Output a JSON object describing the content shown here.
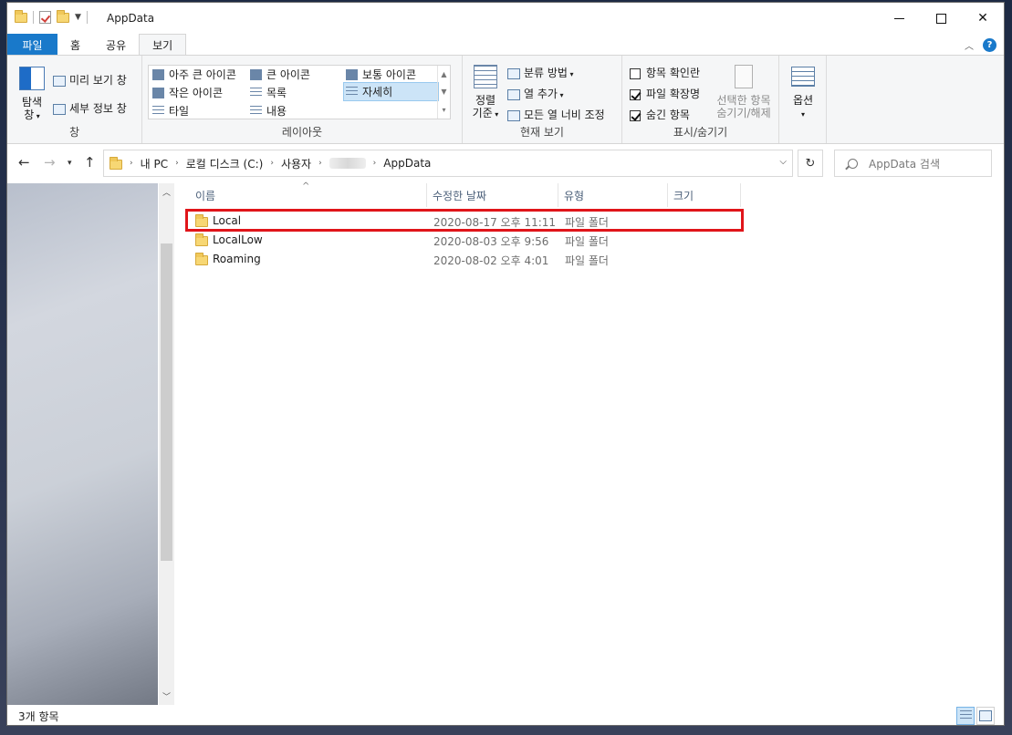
{
  "window": {
    "title": "AppData"
  },
  "tabs": [
    {
      "label": "파일"
    },
    {
      "label": "홈"
    },
    {
      "label": "공유"
    },
    {
      "label": "보기"
    }
  ],
  "ribbon": {
    "panes": {
      "nav_pane_line1": "탐색",
      "nav_pane_line2": "창",
      "preview": "미리 보기 창",
      "details": "세부 정보 창",
      "label": "창"
    },
    "layout": {
      "items": [
        "아주 큰 아이콘",
        "큰 아이콘",
        "보통 아이콘",
        "작은 아이콘",
        "목록",
        "자세히",
        "타일",
        "내용"
      ],
      "selected": "자세히",
      "label": "레이아웃"
    },
    "current_view": {
      "sort_line1": "정렬",
      "sort_line2": "기준",
      "group_by": "분류 방법",
      "add_columns": "열 추가",
      "size_columns": "모든 열 너비 조정",
      "label": "현재 보기"
    },
    "show_hide": {
      "item_checkboxes": {
        "label": "항목 확인란",
        "checked": false
      },
      "file_extensions": {
        "label": "파일 확장명",
        "checked": true
      },
      "hidden_items": {
        "label": "숨긴 항목",
        "checked": true
      },
      "hide_selected_line1": "선택한 항목",
      "hide_selected_line2": "숨기기/해제",
      "label": "표시/숨기기"
    },
    "options": {
      "label": "옵션"
    }
  },
  "address": {
    "crumbs": [
      "내 PC",
      "로컬 디스크 (C:)",
      "사용자",
      "AppData"
    ]
  },
  "search": {
    "placeholder": "AppData 검색"
  },
  "columns": [
    "이름",
    "수정한 날짜",
    "유형",
    "크기"
  ],
  "files": [
    {
      "name": "Local",
      "modified": "2020-08-17 오후 11:11",
      "type": "파일 폴더",
      "size": ""
    },
    {
      "name": "LocalLow",
      "modified": "2020-08-03 오후 9:56",
      "type": "파일 폴더",
      "size": ""
    },
    {
      "name": "Roaming",
      "modified": "2020-08-02 오후 4:01",
      "type": "파일 폴더",
      "size": ""
    }
  ],
  "status": {
    "count": "3개 항목"
  },
  "colors": {
    "accent": "#1979ca",
    "highlight": "#e0151a",
    "selection": "#cce4f7"
  }
}
